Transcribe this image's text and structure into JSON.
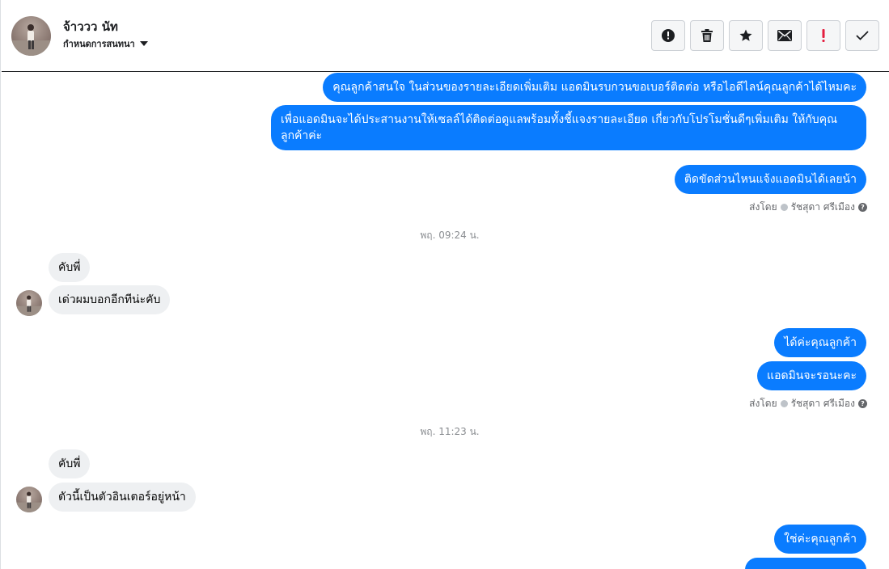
{
  "header": {
    "contact_name": "จ้าววว นัท",
    "assign_label": "กำหนดการสนทนา",
    "toolbar": [
      {
        "name": "mark-spam-button",
        "icon": "alert-circle-icon"
      },
      {
        "name": "delete-button",
        "icon": "trash-icon"
      },
      {
        "name": "star-button",
        "icon": "star-icon"
      },
      {
        "name": "mark-unread-button",
        "icon": "envelope-icon"
      },
      {
        "name": "follow-up-button",
        "icon": "exclamation-icon"
      },
      {
        "name": "mark-done-button",
        "icon": "check-icon"
      }
    ]
  },
  "messages": {
    "out_1": "คุณลูกค้าสนใจ ในส่วนของรายละเอียดเพิ่มเติม แอดมินรบกวนขอเบอร์ติดต่อ หรือไอดีไลน์คุณลูกค้าได้ไหมคะ",
    "out_2": "เพื่อแอดมินจะได้ประสานงานให้เซลล์ได้ติดต่อดูแลพร้อมทั้งชี้แจงรายละเอียด เกี่ยวกับโปรโมชั่นดีๆเพิ่มเติม ให้กับคุณลูกค้าค่ะ",
    "out_3": "ติดขัดส่วนไหนแจ้งแอดมินได้เลยน้า",
    "sent_by_1": "ส่งโดย",
    "agent_1": "รัชสุดา ศรีเมือง",
    "time_1": "พฤ. 09:24 น.",
    "in_1": "คับพี่",
    "in_2": "เด่วผมบอกอีกทีน่ะคับ",
    "out_4": "ได้ค่ะคุณลูกค้า",
    "out_5": "แอดมินจะรอนะคะ",
    "sent_by_2": "ส่งโดย",
    "agent_2": "รัชสุดา ศรีเมือง",
    "time_2": "พฤ. 11:23 น.",
    "in_3": "คับพี่",
    "in_4": "ตัวนี้เป็นตัวอินเตอร์อยู่หน้า",
    "out_6": "ใช่ค่ะคุณลูกค้า"
  },
  "colors": {
    "outgoing_bubble": "#0a7cff",
    "incoming_bubble": "#eef0f2",
    "follow_up_icon": "#e41e3f"
  }
}
